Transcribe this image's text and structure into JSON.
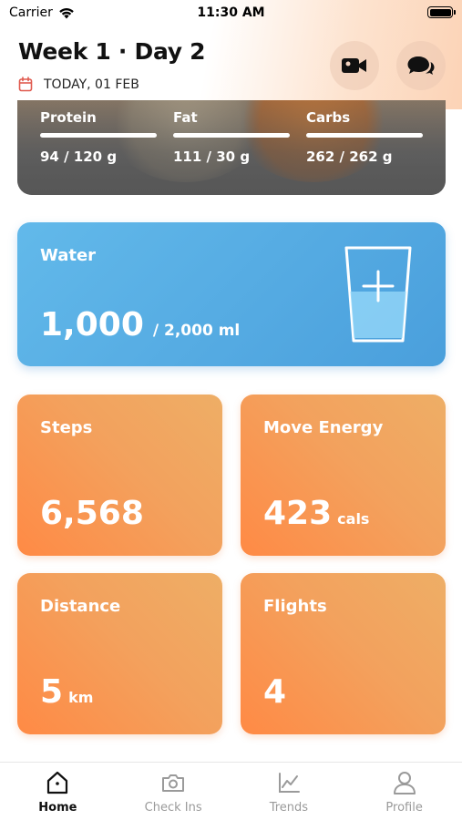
{
  "status_bar": {
    "carrier": "Carrier",
    "time": "11:30 AM"
  },
  "header": {
    "title": "Week 1 · Day 2",
    "date": "TODAY, 01 FEB"
  },
  "macros": [
    {
      "label": "Protein",
      "value": "94 / 120 g"
    },
    {
      "label": "Fat",
      "value": "111 / 30 g"
    },
    {
      "label": "Carbs",
      "value": "262 / 262 g"
    }
  ],
  "water": {
    "label": "Water",
    "value": "1,000",
    "target": "/  2,000 ml"
  },
  "tiles": {
    "steps": {
      "label": "Steps",
      "value": "6,568",
      "unit": ""
    },
    "move_energy": {
      "label": "Move Energy",
      "value": "423",
      "unit": "cals"
    },
    "distance": {
      "label": "Distance",
      "value": "5",
      "unit": "km"
    },
    "flights": {
      "label": "Flights",
      "value": "4",
      "unit": ""
    }
  },
  "tabs": [
    {
      "label": "Home",
      "icon": "home-icon",
      "active": true
    },
    {
      "label": "Check Ins",
      "icon": "camera-icon",
      "active": false
    },
    {
      "label": "Trends",
      "icon": "trends-icon",
      "active": false
    },
    {
      "label": "Profile",
      "icon": "profile-icon",
      "active": false
    }
  ],
  "colors": {
    "water_card": "#4a9fdc",
    "tile_orange": "#f3a15d",
    "date_icon": "#e05a4f"
  }
}
